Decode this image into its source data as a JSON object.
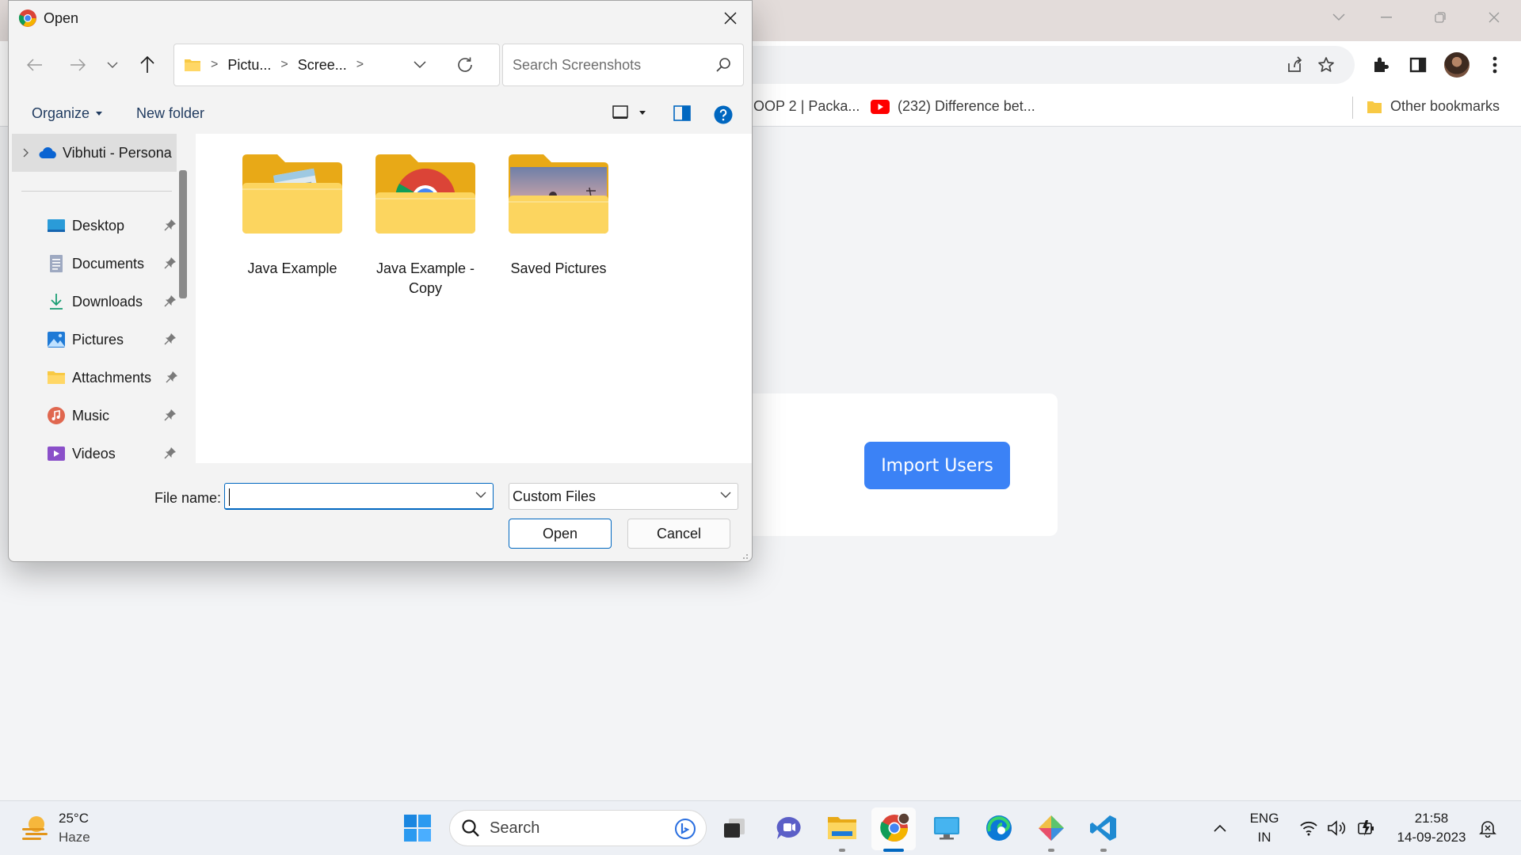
{
  "dialog": {
    "title": "Open",
    "address": {
      "segments": [
        "Pictu...",
        "Scree..."
      ]
    },
    "search_placeholder": "Search Screenshots",
    "toolbar": {
      "organize": "Organize",
      "new_folder": "New folder"
    },
    "nav": {
      "top_item": "Vibhuti - Persona",
      "items": [
        {
          "label": "Desktop",
          "icon": "desktop-icon"
        },
        {
          "label": "Documents",
          "icon": "documents-icon"
        },
        {
          "label": "Downloads",
          "icon": "downloads-icon"
        },
        {
          "label": "Pictures",
          "icon": "pictures-icon"
        },
        {
          "label": "Attachments",
          "icon": "folder-icon"
        },
        {
          "label": "Music",
          "icon": "music-icon"
        },
        {
          "label": "Videos",
          "icon": "videos-icon"
        }
      ]
    },
    "files": [
      {
        "name": "Java Example",
        "thumb": "notepad-folder"
      },
      {
        "name": "Java Example - Copy",
        "thumb": "chrome-folder"
      },
      {
        "name": "Saved Pictures",
        "thumb": "photo-folder"
      }
    ],
    "footer": {
      "file_name_label": "File name:",
      "file_name_value": "",
      "file_type": "Custom Files",
      "open": "Open",
      "cancel": "Cancel"
    }
  },
  "browser": {
    "bookmarks": [
      {
        "label": "OOP 2 | Packa..."
      },
      {
        "label": "(232) Difference bet...",
        "icon": "youtube-icon"
      },
      {
        "label": "Other bookmarks",
        "icon": "folder-icon"
      }
    ],
    "import_button": "Import Users"
  },
  "taskbar": {
    "weather": {
      "temp": "25°C",
      "condition": "Haze"
    },
    "search_label": "Search",
    "language": {
      "line1": "ENG",
      "line2": "IN"
    },
    "clock": {
      "time": "21:58",
      "date": "14-09-2023"
    }
  },
  "colors": {
    "accent": "#0067c0",
    "import_button": "#3b82f6",
    "folder_yellow": "#f8c944"
  }
}
